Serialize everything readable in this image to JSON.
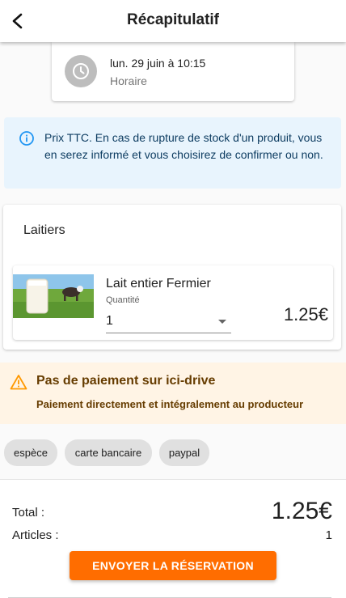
{
  "header": {
    "title": "Récapitulatif",
    "back_icon": "arrow-back-icon"
  },
  "schedule": {
    "icon": "clock-icon",
    "date": "lun. 29 juin à 10:15",
    "label": "Horaire"
  },
  "info": {
    "icon": "info-icon",
    "text": "Prix TTC. En cas de rupture de stock d'un produit, vous en serez informé et vous choisirez de confirmer ou non."
  },
  "category": {
    "title": "Laitiers",
    "products": [
      {
        "name": "Lait entier Fermier",
        "quantity_label": "Quantité",
        "quantity": "1",
        "price": "1.25€"
      }
    ]
  },
  "warning": {
    "icon": "warning-icon",
    "title": "Pas de paiement sur ici-drive",
    "subtitle": "Paiement directement et intégralement au producteur"
  },
  "payment_methods": [
    "espèce",
    "carte bancaire",
    "paypal"
  ],
  "footer": {
    "total_label": "Total :",
    "total_value": "1.25€",
    "articles_label": "Articles :",
    "articles_value": "1",
    "submit_label": "ENVOYER LA RÉSERVATION"
  },
  "colors": {
    "accent": "#ff6d00",
    "info_bg": "#e8f4fd",
    "info_icon": "#2196f3",
    "warning_bg": "#fff4e5",
    "warning_icon": "#ff9800",
    "warning_text": "#663c00"
  }
}
